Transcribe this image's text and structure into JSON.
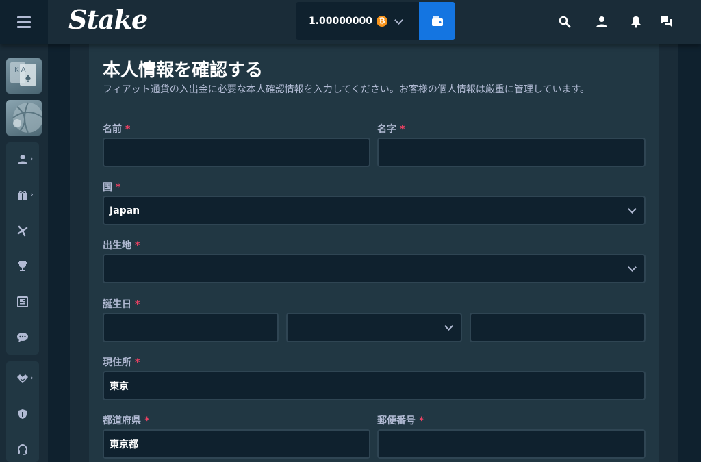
{
  "header": {
    "logo_text": "Stake",
    "balance": "1.00000000",
    "currency_symbol": "₿",
    "icons": [
      "menu-icon",
      "chevron-down-icon",
      "wallet-icon",
      "search-icon",
      "user-icon",
      "bell-icon",
      "chat-icon"
    ]
  },
  "sidebar": {
    "thumbnails": [
      "casino",
      "sports"
    ],
    "group1": [
      "user-icon",
      "gift-icon",
      "affiliate-icon",
      "trophy-icon",
      "blog-icon",
      "forum-icon"
    ],
    "group2": [
      "sponsorship-icon",
      "shield-icon",
      "headset-icon"
    ],
    "casino_card_text": "K A"
  },
  "form": {
    "title": "本人情報を確認する",
    "description": "フィアット通貨の入出金に必要な本人確認情報を入力してください。お客様の個人情報は厳重に管理しています。",
    "required_mark": "*",
    "first_name": {
      "label": "名前",
      "value": ""
    },
    "last_name": {
      "label": "名字",
      "value": ""
    },
    "country": {
      "label": "国",
      "value": "Japan"
    },
    "birthplace": {
      "label": "出生地",
      "value": ""
    },
    "birthday": {
      "label": "誕生日",
      "day": "",
      "month": "",
      "year": ""
    },
    "address": {
      "label": "現住所",
      "value": "東京"
    },
    "prefecture": {
      "label": "都道府県",
      "value": "東京都"
    },
    "postal_code": {
      "label": "郵便番号",
      "value": ""
    }
  },
  "colors": {
    "background": "#0f212e",
    "surface": "#1a2c38",
    "panel": "#213743",
    "accent_blue": "#1475e1",
    "required_red": "#ed4163",
    "btc_orange": "#f7931a"
  }
}
